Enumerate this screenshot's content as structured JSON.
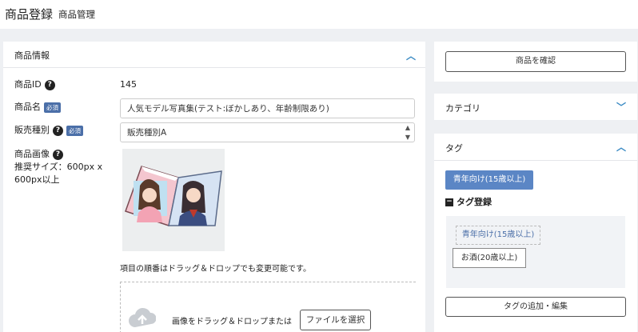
{
  "header": {
    "title": "商品登録",
    "subtitle": "商品管理"
  },
  "product_info": {
    "section_title": "商品情報",
    "id_label": "商品ID",
    "id_value": "145",
    "name_label": "商品名",
    "name_value": "人気モデル写真集(テスト:ぼかしあり、年齢制限あり)",
    "type_label": "販売種別",
    "type_value": "販売種別A",
    "required_badge": "必須",
    "image_label": "商品画像",
    "image_hint": "推奨サイズ：600px x 600px以上",
    "reorder_note": "項目の順番はドラッグ＆ドロップでも変更可能です。",
    "drop_text": "画像をドラッグ＆ドロップまたは",
    "file_button": "ファイルを選択"
  },
  "sidebar": {
    "confirm_button": "商品を確認",
    "category_title": "カテゴリ",
    "tag_title": "タグ",
    "tag_primary": "青年向け(15歳以上)",
    "tag_register_label": "タグ登録",
    "tag_options": [
      "青年向け(15歳以上)",
      "お酒(20歳以上)"
    ],
    "tag_edit_button": "タグの追加・編集"
  },
  "colors": {
    "accent": "#3b8bc4",
    "tag_blue": "#5b86c5",
    "required": "#4b6fa8"
  }
}
